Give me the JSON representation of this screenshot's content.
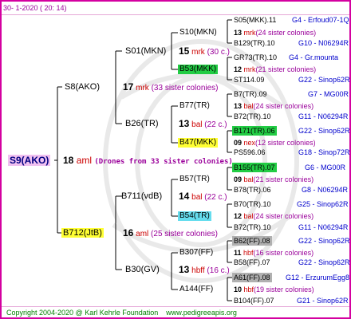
{
  "header": {
    "date": "30-  1-2020 ( 20: 14)"
  },
  "footer": {
    "copyright": "Copyright 2004-2020 @ Karl Kehrle Foundation",
    "site": "www.pedigreeapis.org"
  },
  "root": {
    "name": "S9(AKO)",
    "num": "18",
    "code": "aml",
    "note": "(Drones from 33 sister colonies)"
  },
  "gen2": [
    {
      "name": "S8(AKO)",
      "num": "17",
      "code": "mrk",
      "note": "(33 sister colonies)"
    },
    {
      "name": "B712(JtB)",
      "num": "16",
      "code": "aml",
      "note": "(25 sister colonies)"
    }
  ],
  "gen3": [
    {
      "name": "S01(MKN)",
      "num": "15",
      "code": "mrk",
      "note": "(30 c.)"
    },
    {
      "name": "B26(TR)",
      "num": "13",
      "code": "bal",
      "note": "(22 c.)"
    },
    {
      "name": "B711(vdB)",
      "num": "14",
      "code": "bal",
      "note": "(22 c.)"
    },
    {
      "name": "B30(GV)",
      "num": "13",
      "code": "hbff",
      "note": "(16 c.)"
    }
  ],
  "gen4": [
    {
      "name": "S10(MKN)",
      "num": "13",
      "code": "mrk",
      "note": "(24 sister colonies)"
    },
    {
      "name": "B53(MKK)",
      "num": "12",
      "code": "mrk",
      "note": "(21 sister colonies)"
    },
    {
      "name": "B77(TR)",
      "num": "13",
      "code": "bal",
      "note": "(24 sister colonies)"
    },
    {
      "name": "B47(MKK)",
      "num": "09",
      "code": "nex",
      "note": "(12 sister colonies)"
    },
    {
      "name": "B57(TR)",
      "num": "09",
      "code": "bal",
      "note": "(21 sister colonies)"
    },
    {
      "name": "B54(TR)",
      "num": "12",
      "code": "bal",
      "note": "(24 sister colonies)"
    },
    {
      "name": "B307(FF)",
      "num": "11",
      "code": "hbf",
      "note": "(16 sister colonies)"
    },
    {
      "name": "A144(FF)",
      "num": "10",
      "code": "hbf",
      "note": "(19 sister colonies)"
    }
  ],
  "gen5": [
    {
      "name": "S05(MKK).11",
      "dest": "G4 - Erfoud07-1Q"
    },
    {
      "name": "B129(TR).10",
      "dest": "G10 - N06294R"
    },
    {
      "name": "GR73(TR).10",
      "dest": "G4 - Gr.mounta"
    },
    {
      "name": "ST114.09",
      "dest": "G22 - Sinop62R"
    },
    {
      "name": "B7(TR).09",
      "dest": "G7 - MG00R"
    },
    {
      "name": "B72(TR).10",
      "dest": "G11 - N06294R"
    },
    {
      "name": "B171(TR).06",
      "dest": "G22 - Sinop62R"
    },
    {
      "name": "PS596.06",
      "dest": "G18 - Sinop72R"
    },
    {
      "name": "B155(TR).07",
      "dest": "G6 - MG00R"
    },
    {
      "name": "B78(TR).06",
      "dest": "G8 - N06294R"
    },
    {
      "name": "B70(TR).10",
      "dest": "G25 - Sinop62R"
    },
    {
      "name": "B72(TR).10",
      "dest": "G11 - N06294R"
    },
    {
      "name": "B62(FF).08",
      "dest": "G22 - Sinop62R"
    },
    {
      "name": "B58(FF).07",
      "dest": "G22 - Sinop62R"
    },
    {
      "name": "A61(FF).08",
      "dest": "G12 - ErzurumEgg8"
    },
    {
      "name": "B104(FF).07",
      "dest": "G21 - Sinop62R"
    }
  ]
}
